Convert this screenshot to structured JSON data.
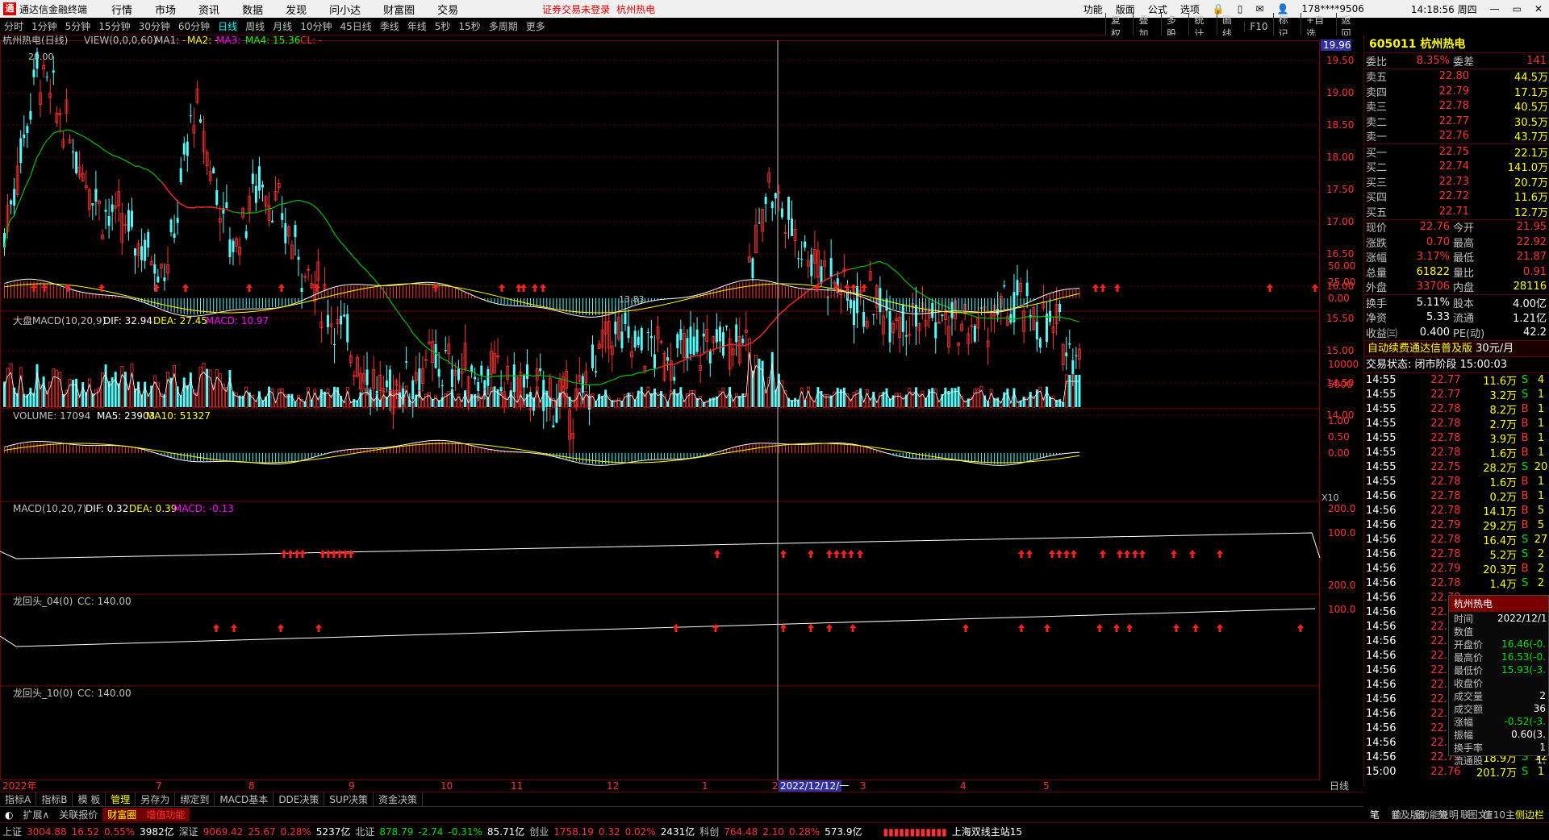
{
  "app": {
    "title": "通达信金融终端",
    "menu": [
      "行情",
      "市场",
      "资讯",
      "数据",
      "发现",
      "问小达",
      "财富圈",
      "交易"
    ],
    "warning": "证券交易未登录",
    "stock_name_title": "杭州热电",
    "right_menu": [
      "功能",
      "版面",
      "公式",
      "选项"
    ],
    "account": "178****9506",
    "clock": "14:18:56 周四"
  },
  "periods": [
    "分时",
    "1分钟",
    "5分钟",
    "15分钟",
    "30分钟",
    "60分钟",
    "日线",
    "周线",
    "月线",
    "10分钟",
    "45日线",
    "季线",
    "年线",
    "5秒",
    "15秒",
    "多周期",
    "更多"
  ],
  "active_period": "日线",
  "tools": [
    "复权",
    "叠加",
    "多股",
    "统计",
    "画线",
    "F10",
    "标记",
    "+自选",
    "返回"
  ],
  "main_chart": {
    "legend_name": "杭州热电(日线)",
    "legend_view": "VIEW(0,0,0,60)",
    "ma1": "MA1: -",
    "ma2": "MA2: -",
    "ma3": "MA3: -",
    "ma4": "MA4: 15.36",
    "cl": "CL: -",
    "price_labels": [
      "19.50",
      "19.00",
      "18.50",
      "18.00",
      "17.50",
      "17.00",
      "16.50",
      "16.00",
      "15.50",
      "15.00",
      "14.50",
      "14.00"
    ],
    "cursor_price": "19.96",
    "high_mark": "20.00",
    "low_mark": "13.83",
    "colors": {
      "up": "#ff3232",
      "down": "#54fcfc",
      "ma": "#00c000",
      "ma_red": "#ff2020"
    }
  },
  "macd_big": {
    "title": "大盘MACD(10,20,9)",
    "dif": "DIF: 32.94",
    "dea": "DEA: 27.45",
    "macd": "MACD: 10.97",
    "labels": [
      "50.00",
      "25.00",
      "0.00"
    ]
  },
  "volume": {
    "title": "VOLUME: 17094",
    "ma5": "MA5: 23903",
    "ma10": "MA10: 51327",
    "labels": [
      "10000",
      "5000"
    ],
    "unit": "X10"
  },
  "macd": {
    "title": "MACD(10,20,7)",
    "dif": "DIF: 0.32",
    "dea": "DEA: 0.39",
    "macd": "MACD: -0.13",
    "labels": [
      "1.00",
      "0.50",
      "0.00"
    ]
  },
  "dragon1": {
    "title": "龙回头_04(0)",
    "cc": "CC: 140.00",
    "labels": [
      "200.0",
      "100.0"
    ]
  },
  "dragon2": {
    "title": "龙回头_10(0)",
    "cc": "CC: 140.00",
    "labels": [
      "200.0",
      "100.0"
    ]
  },
  "xaxis": {
    "start": "2022年",
    "months": [
      "7",
      "8",
      "9",
      "10",
      "11",
      "12",
      "1",
      "2",
      "3",
      "4",
      "5"
    ],
    "cursor_date": "2022/12/12/一",
    "unit": "日线"
  },
  "quote": {
    "code_name": "605011 杭州热电",
    "weibi_label": "委比",
    "weibi": "8.35%",
    "weicha_label": "委差",
    "weicha": "141",
    "asks": [
      {
        "l": "卖五",
        "p": "22.80",
        "v": "44.5万"
      },
      {
        "l": "卖四",
        "p": "22.79",
        "v": "17.1万"
      },
      {
        "l": "卖三",
        "p": "22.78",
        "v": "40.5万"
      },
      {
        "l": "卖二",
        "p": "22.77",
        "v": "30.5万"
      },
      {
        "l": "卖一",
        "p": "22.76",
        "v": "43.7万"
      }
    ],
    "bids": [
      {
        "l": "买一",
        "p": "22.75",
        "v": "22.1万"
      },
      {
        "l": "买二",
        "p": "22.74",
        "v": "141.0万"
      },
      {
        "l": "买三",
        "p": "22.73",
        "v": "20.7万"
      },
      {
        "l": "买四",
        "p": "22.72",
        "v": "11.6万"
      },
      {
        "l": "买五",
        "p": "22.71",
        "v": "12.7万"
      }
    ],
    "stats": [
      {
        "a": "现价",
        "b": "22.76",
        "c": "今开",
        "d": "21.95"
      },
      {
        "a": "涨跌",
        "b": "0.70",
        "c": "最高",
        "d": "22.92"
      },
      {
        "a": "涨幅",
        "b": "3.17%",
        "c": "最低",
        "d": "21.87"
      },
      {
        "a": "总量",
        "b": "61822",
        "c": "量比",
        "d": "0.91"
      },
      {
        "a": "外盘",
        "b": "33706",
        "c": "内盘",
        "d": "28116"
      }
    ],
    "stats2": [
      {
        "a": "换手",
        "b": "5.11%",
        "c": "股本",
        "d": "4.00亿"
      },
      {
        "a": "净资",
        "b": "5.33",
        "c": "流通",
        "d": "1.21亿"
      },
      {
        "a": "收益㈢",
        "b": "0.400",
        "c": "PE(动)",
        "d": "42.2"
      }
    ],
    "ad": "自动续费通达信普及版",
    "ad_price": "30元/月",
    "trade_state": "交易状态: 闭市阶段 15:00:03"
  },
  "ticks": [
    {
      "t": "14:55",
      "p": "22.77",
      "v": "11.6万",
      "bs": "S",
      "n": "4"
    },
    {
      "t": "14:55",
      "p": "22.77",
      "v": "3.2万",
      "bs": "S",
      "n": "1"
    },
    {
      "t": "14:55",
      "p": "22.78",
      "v": "8.2万",
      "bs": "B",
      "n": "1"
    },
    {
      "t": "14:55",
      "p": "22.78",
      "v": "2.7万",
      "bs": "B",
      "n": "1"
    },
    {
      "t": "14:55",
      "p": "22.78",
      "v": "3.9万",
      "bs": "B",
      "n": "1"
    },
    {
      "t": "14:55",
      "p": "22.78",
      "v": "1.6万",
      "bs": "B",
      "n": "1"
    },
    {
      "t": "14:55",
      "p": "22.75",
      "v": "28.2万",
      "bs": "S",
      "n": "20"
    },
    {
      "t": "14:55",
      "p": "22.78",
      "v": "1.6万",
      "bs": "B",
      "n": "1"
    },
    {
      "t": "14:56",
      "p": "22.78",
      "v": "0.2万",
      "bs": "B",
      "n": "1"
    },
    {
      "t": "14:56",
      "p": "22.78",
      "v": "14.1万",
      "bs": "B",
      "n": "5"
    },
    {
      "t": "14:56",
      "p": "22.79",
      "v": "29.2万",
      "bs": "B",
      "n": "5"
    },
    {
      "t": "14:56",
      "p": "22.78",
      "v": "16.4万",
      "bs": "S",
      "n": "27"
    },
    {
      "t": "14:56",
      "p": "22.78",
      "v": "5.2万",
      "bs": "S",
      "n": "2"
    },
    {
      "t": "14:56",
      "p": "22.79",
      "v": "20.3万",
      "bs": "B",
      "n": "2"
    },
    {
      "t": "14:56",
      "p": "22.78",
      "v": "1.4万",
      "bs": "S",
      "n": "2"
    },
    {
      "t": "14:56",
      "p": "22.78",
      "v": "",
      "bs": "",
      "n": ""
    },
    {
      "t": "14:56",
      "p": "22.77",
      "v": "",
      "bs": "",
      "n": ""
    },
    {
      "t": "14:56",
      "p": "22.78",
      "v": "",
      "bs": "",
      "n": ""
    },
    {
      "t": "14:56",
      "p": "22.78",
      "v": "",
      "bs": "",
      "n": ""
    },
    {
      "t": "14:56",
      "p": "22.78",
      "v": "",
      "bs": "",
      "n": ""
    },
    {
      "t": "14:56",
      "p": "22.78",
      "v": "",
      "bs": "",
      "n": ""
    },
    {
      "t": "14:56",
      "p": "22.78",
      "v": "",
      "bs": "",
      "n": ""
    },
    {
      "t": "14:56",
      "p": "22.78",
      "v": "",
      "bs": "",
      "n": ""
    },
    {
      "t": "14:56",
      "p": "22.78",
      "v": "",
      "bs": "",
      "n": ""
    },
    {
      "t": "14:56",
      "p": "22.78",
      "v": "",
      "bs": "",
      "n": ""
    },
    {
      "t": "14:56",
      "p": "22.78",
      "v": "",
      "bs": "",
      "n": ""
    },
    {
      "t": "14:56",
      "p": "22.77",
      "v": "18.9万",
      "bs": "S",
      "n": "12"
    },
    {
      "t": "15:00",
      "p": "22.76",
      "v": "201.7万",
      "bs": "S",
      "n": "1"
    }
  ],
  "popup": {
    "title": "杭州热电",
    "rows": [
      {
        "k": "时间",
        "v": "2022/12/1"
      },
      {
        "k": "数值",
        "v": ""
      },
      {
        "k": "开盘价",
        "v": "16.46(-0."
      },
      {
        "k": "最高价",
        "v": "16.53(-0."
      },
      {
        "k": "最低价",
        "v": "15.93(-3."
      },
      {
        "k": "收盘价",
        "v": ""
      },
      {
        "k": "成交量",
        "v": "2"
      },
      {
        "k": "成交额",
        "v": "36"
      },
      {
        "k": "涨幅",
        "v": "-0.52(-3."
      },
      {
        "k": "振幅",
        "v": "0.60(3."
      },
      {
        "k": "换手率",
        "v": "1"
      },
      {
        "k": "流通股",
        "v": "1."
      }
    ]
  },
  "bottom_tabs": [
    "指标A",
    "指标B",
    "模 板",
    "管理",
    "另存为",
    "绑定到",
    "MACD基本",
    "DDE决策",
    "SUP决策",
    "资金决策"
  ],
  "bottom_tabs2": [
    "扩展∧",
    "关联报价",
    "财富圈",
    "增值功能"
  ],
  "bottom_right": [
    "普及版功能说明",
    "图文F10",
    "侧边栏"
  ],
  "rp_bottom": [
    "笔",
    "价",
    "细",
    "势",
    "联",
    "值",
    "主"
  ],
  "status": {
    "sh_label": "上证",
    "sh": "3004.88",
    "sh_chg": "16.52",
    "sh_pct": "0.55%",
    "sh_amt": "3982亿",
    "sz_label": "深证",
    "sz": "9069.42",
    "sz_chg": "25.67",
    "sz_pct": "0.28%",
    "sz_amt": "5237亿",
    "bz_label": "北证",
    "bz": "878.79",
    "bz_chg": "-2.74",
    "bz_pct": "-0.31%",
    "bz_amt": "85.71亿",
    "cy_label": "创业",
    "cy": "1758.19",
    "cy_chg": "0.32",
    "cy_pct": "0.02%",
    "cy_amt": "2431亿",
    "kc_label": "科创",
    "kc": "764.48",
    "kc_chg": "2.10",
    "kc_pct": "0.28%",
    "kc_amt": "573.9亿",
    "server": "上海双线主站15"
  }
}
